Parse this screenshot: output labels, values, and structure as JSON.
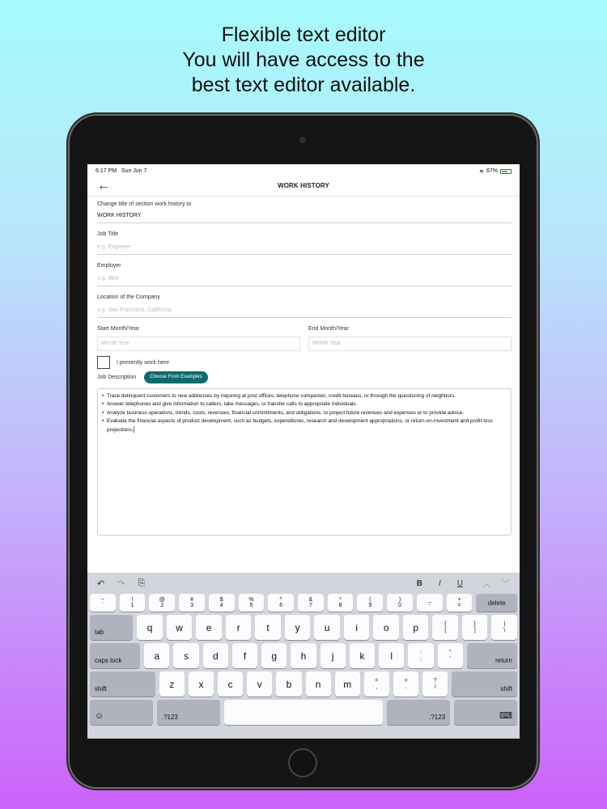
{
  "headline": {
    "line1": "Flexible text editor",
    "line2": "You will have access to the",
    "line3": "best text editor available."
  },
  "status": {
    "time": "6:17 PM",
    "date": "Sun Jun 7",
    "battery": "67%"
  },
  "nav": {
    "back_icon": "←",
    "title": "WORK HISTORY"
  },
  "form": {
    "section_title_label": "Change title of section work history to",
    "section_title_value": "WORK HISTORY",
    "job_title_label": "Job Title",
    "job_title_placeholder": "e.g. Engineer",
    "employer_label": "Employer",
    "employer_placeholder": "e.g. IBM",
    "location_label": "Location of the Company",
    "location_placeholder": "e.g. San Francisco, California",
    "start_label": "Start Month/Year",
    "start_placeholder": "Month Year",
    "end_label": "End Month/Year",
    "end_placeholder": "Month Year",
    "present_label": "I presently work here",
    "job_desc_label": "Job Description",
    "examples_button": "Choose From Examples",
    "description": [
      "Trace delinquent customers to new addresses by inquiring at post offices, telephone companies, credit bureaus, or through the questioning of neighbors.",
      "Answer telephones and give information to callers, take messages, or transfer calls to appropriate individuals.",
      "Analyze business operations, trends, costs, revenues, financial commitments, and obligations, to project future revenues and expenses or to provide advice.",
      "Evaluate the financial aspects of product development, such as budgets, expenditures, research and development appropriations, or return-on-investment and profit-loss projections."
    ]
  },
  "keyboard": {
    "toolbar": {
      "undo": "↶",
      "redo": "↷",
      "paste": "⎘",
      "bold": "B",
      "italic": "I",
      "underline": "U",
      "up": "︿",
      "down": "﹀"
    },
    "row0": [
      {
        "top": "~",
        "bottom": "`"
      },
      {
        "top": "!",
        "bottom": "1"
      },
      {
        "top": "@",
        "bottom": "2"
      },
      {
        "top": "#",
        "bottom": "3"
      },
      {
        "top": "$",
        "bottom": "4"
      },
      {
        "top": "%",
        "bottom": "5"
      },
      {
        "top": "^",
        "bottom": "6"
      },
      {
        "top": "&",
        "bottom": "7"
      },
      {
        "top": "*",
        "bottom": "8"
      },
      {
        "top": "(",
        "bottom": "9"
      },
      {
        "top": ")",
        "bottom": "0"
      },
      {
        "top": "_",
        "bottom": "-"
      },
      {
        "top": "+",
        "bottom": "="
      }
    ],
    "delete": "delete",
    "tab": "tab",
    "row1": [
      "q",
      "w",
      "e",
      "r",
      "t",
      "y",
      "u",
      "i",
      "o",
      "p"
    ],
    "row1_extra": [
      {
        "top": "{",
        "bottom": "["
      },
      {
        "top": "}",
        "bottom": "]"
      },
      {
        "top": "|",
        "bottom": "\\"
      }
    ],
    "caps": "caps lock",
    "row2": [
      "a",
      "s",
      "d",
      "f",
      "g",
      "h",
      "j",
      "k",
      "l"
    ],
    "row2_extra": [
      {
        "top": ":",
        "bottom": ";"
      },
      {
        "top": "\"",
        "bottom": "'"
      }
    ],
    "return": "return",
    "shift": "shift",
    "row3": [
      "z",
      "x",
      "c",
      "v",
      "b",
      "n",
      "m"
    ],
    "row3_extra": [
      {
        "top": "<",
        "bottom": ","
      },
      {
        "top": ">",
        "bottom": "."
      },
      {
        "top": "?",
        "bottom": "/"
      }
    ],
    "emoji": "☺",
    "num": ".?123",
    "hide": "⌨"
  }
}
